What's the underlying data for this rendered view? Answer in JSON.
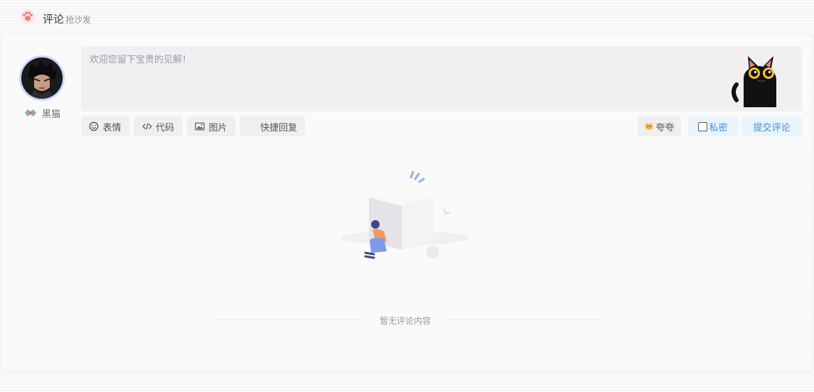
{
  "header": {
    "title": "评论",
    "subtitle": "抢沙发",
    "icon": "paw-icon",
    "accent": "#f28b8b"
  },
  "user": {
    "nickname": "黑猫",
    "avatar": "anime-avatar"
  },
  "editor": {
    "placeholder": "欢迎您留下宝贵的见解！",
    "mascot": "black-cat-icon"
  },
  "toolbar": {
    "emoji_label": "表情",
    "code_label": "代码",
    "image_label": "图片",
    "quick_reply_label": "快捷回复",
    "praise_label": "夸夸",
    "private_label": "私密",
    "submit_label": "提交评论"
  },
  "empty_state": {
    "text": "暂无评论内容"
  },
  "colors": {
    "primary": "#3b8fe0",
    "button_bg": "#f1eef1",
    "blue_button_bg": "#e9f4fd"
  }
}
